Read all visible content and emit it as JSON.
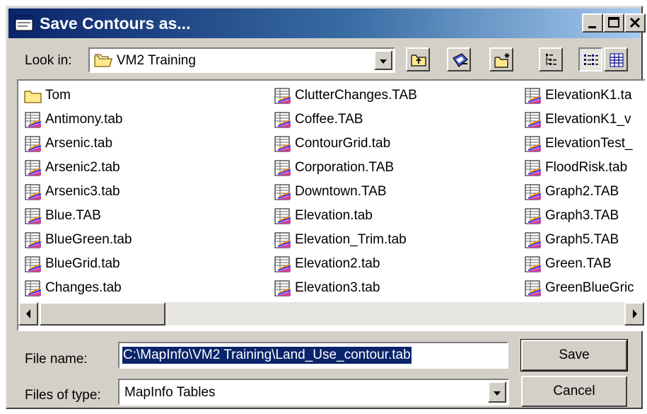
{
  "window": {
    "title": "Save Contours as...",
    "controls": {
      "minimize": "minimize-icon",
      "maximize": "maximize-icon",
      "close": "close-icon"
    }
  },
  "look_in": {
    "label": "Look in:",
    "value": "VM2 Training",
    "icon": "folder-icon"
  },
  "toolbar": {
    "tools": [
      "up-one-level-icon",
      "go-to-desktop-icon",
      "create-new-folder-icon",
      "list-view-icon",
      "details-view-icon"
    ]
  },
  "files": {
    "column1": [
      "Tom",
      "Antimony.tab",
      "Arsenic.tab",
      "Arsenic2.tab",
      "Arsenic3.tab",
      "Blue.TAB",
      "BlueGreen.tab",
      "BlueGrid.tab",
      "Changes.tab"
    ],
    "column2": [
      "ClutterChanges.TAB",
      "Coffee.TAB",
      "ContourGrid.tab",
      "Corporation.TAB",
      "Downtown.TAB",
      "Elevation.tab",
      "Elevation_Trim.tab",
      "Elevation2.tab",
      "Elevation3.tab"
    ],
    "column3": [
      "ElevationK1.ta",
      "ElevationK1_v",
      "ElevationTest_",
      "FloodRisk.tab",
      "Graph2.TAB",
      "Graph3.TAB",
      "Graph5.TAB",
      "Green.TAB",
      "GreenBlueGric"
    ]
  },
  "file_name": {
    "label": "File name:",
    "value": "C:\\MapInfo\\VM2 Training\\Land_Use_contour.tab"
  },
  "file_type": {
    "label": "Files of type:",
    "value": "MapInfo Tables"
  },
  "buttons": {
    "save": "Save",
    "cancel": "Cancel"
  },
  "colors": {
    "title_bar": "#0a246a",
    "selection": "#0a246a",
    "face": "#d4d0c8"
  }
}
